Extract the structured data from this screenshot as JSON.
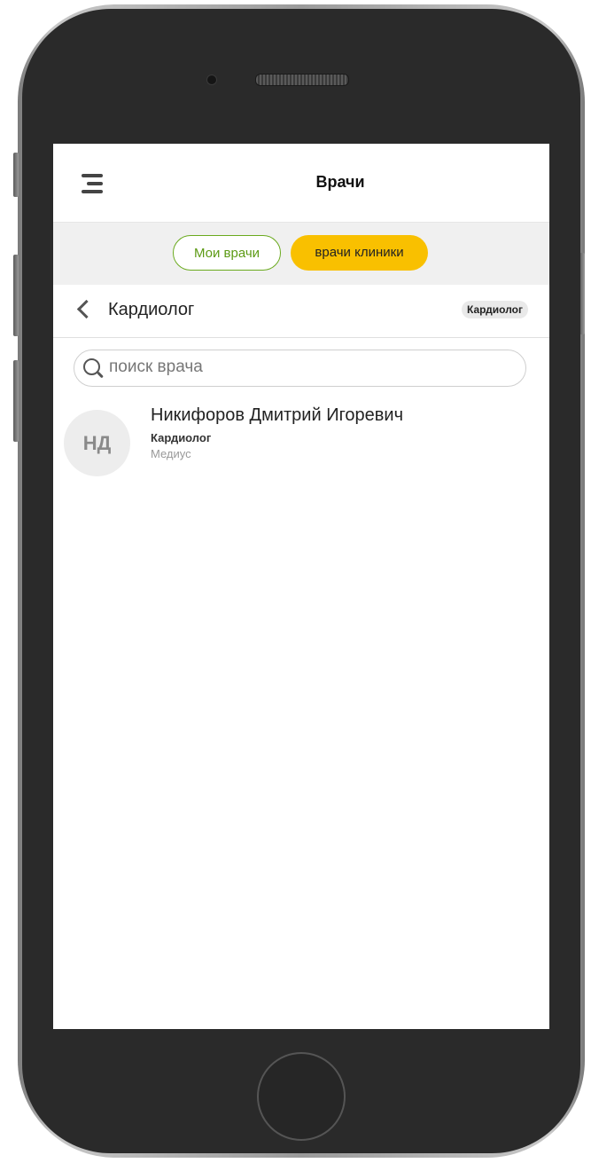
{
  "header": {
    "title": "Врачи",
    "menu_icon": "hamburger-menu-icon"
  },
  "tabs": {
    "my_doctors": "Мои врачи",
    "clinic_doctors": "врачи клиники",
    "active": "clinic_doctors",
    "colors": {
      "my_doctors_border": "#6aaa1e",
      "clinic_active_bg": "#f9c000"
    }
  },
  "specialty": {
    "title": "Кардиолог",
    "chip": "Кардиолог",
    "back_icon": "chevron-left-icon"
  },
  "search": {
    "placeholder": "поиск врача",
    "value": "",
    "icon": "search-icon"
  },
  "doctors": [
    {
      "initials": "НД",
      "name": "Никифоров Дмитрий Игоревич",
      "specialty": "Кардиолог",
      "clinic": "Медиус"
    }
  ]
}
